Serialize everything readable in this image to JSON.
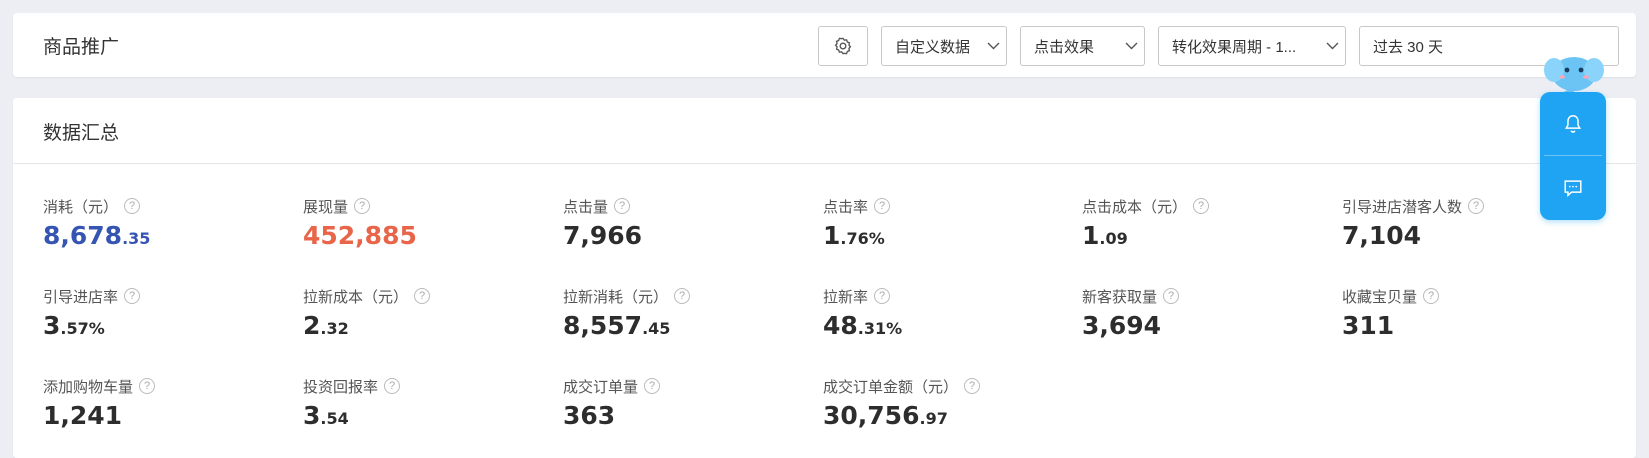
{
  "header": {
    "title": "商品推广",
    "dropdowns": [
      "自定义数据",
      "点击效果",
      "转化效果周期 - 1..."
    ],
    "date_range": "过去 30 天"
  },
  "summary": {
    "title": "数据汇总",
    "metrics": [
      {
        "label": "消耗（元）",
        "int": "8,678",
        "dec": ".35",
        "color": "#3655b3"
      },
      {
        "label": "展现量",
        "int": "452,885",
        "dec": "",
        "color": "#e8654a"
      },
      {
        "label": "点击量",
        "int": "7,966",
        "dec": ""
      },
      {
        "label": "点击率",
        "int": "1",
        "dec": ".76%"
      },
      {
        "label": "点击成本（元）",
        "int": "1",
        "dec": ".09"
      },
      {
        "label": "引导进店潜客人数",
        "int": "7,104",
        "dec": ""
      },
      {
        "label": "引导进店率",
        "int": "3",
        "dec": ".57%"
      },
      {
        "label": "拉新成本（元）",
        "int": "2",
        "dec": ".32"
      },
      {
        "label": "拉新消耗（元）",
        "int": "8,557",
        "dec": ".45"
      },
      {
        "label": "拉新率",
        "int": "48",
        "dec": ".31%"
      },
      {
        "label": "新客获取量",
        "int": "3,694",
        "dec": ""
      },
      {
        "label": "收藏宝贝量",
        "int": "311",
        "dec": ""
      },
      {
        "label": "添加购物车量",
        "int": "1,241",
        "dec": ""
      },
      {
        "label": "投资回报率",
        "int": "3",
        "dec": ".54"
      },
      {
        "label": "成交订单量",
        "int": "363",
        "dec": ""
      },
      {
        "label": "成交订单金额（元）",
        "int": "30,756",
        "dec": ".97"
      }
    ]
  },
  "icons": {
    "settings": "gear-icon",
    "notification": "bell-icon",
    "message": "chat-icon",
    "help": "question-circle-icon",
    "mascot": "elephant-mascot"
  },
  "help_glyph": "?"
}
